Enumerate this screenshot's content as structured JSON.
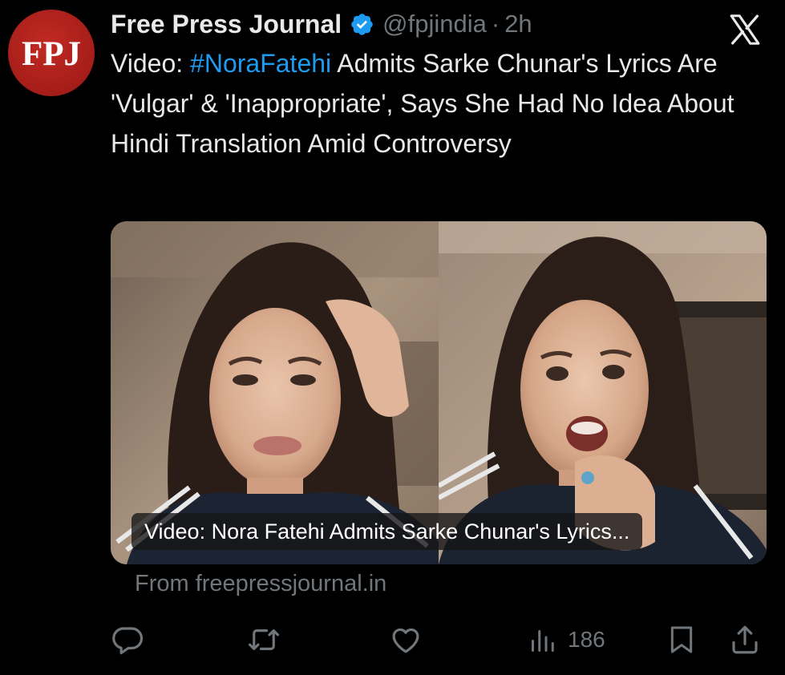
{
  "author": {
    "avatar_text": "FPJ",
    "name": "Free Press Journal",
    "handle": "@fpjindia",
    "separator": "·",
    "time": "2h"
  },
  "tweet": {
    "text_prefix": "Video: ",
    "hashtag": "#NoraFatehi",
    "text_suffix": " Admits Sarke Chunar's Lyrics Are 'Vulgar' & 'Inappropriate', Says She Had No Idea About Hindi Translation Amid Controversy"
  },
  "media": {
    "caption": "Video: Nora Fatehi Admits Sarke Chunar's Lyrics..."
  },
  "link_source": "From freepressjournal.in",
  "actions": {
    "reply_icon": "reply-icon",
    "repost_icon": "repost-icon",
    "like_icon": "like-icon",
    "views_icon": "views-icon",
    "views_count": "186",
    "bookmark_icon": "bookmark-icon",
    "share_icon": "share-icon"
  },
  "colors": {
    "background": "#000000",
    "text": "#e7e9ea",
    "muted": "#71767b",
    "link": "#1d9bf0",
    "avatar": "#a51d19"
  }
}
